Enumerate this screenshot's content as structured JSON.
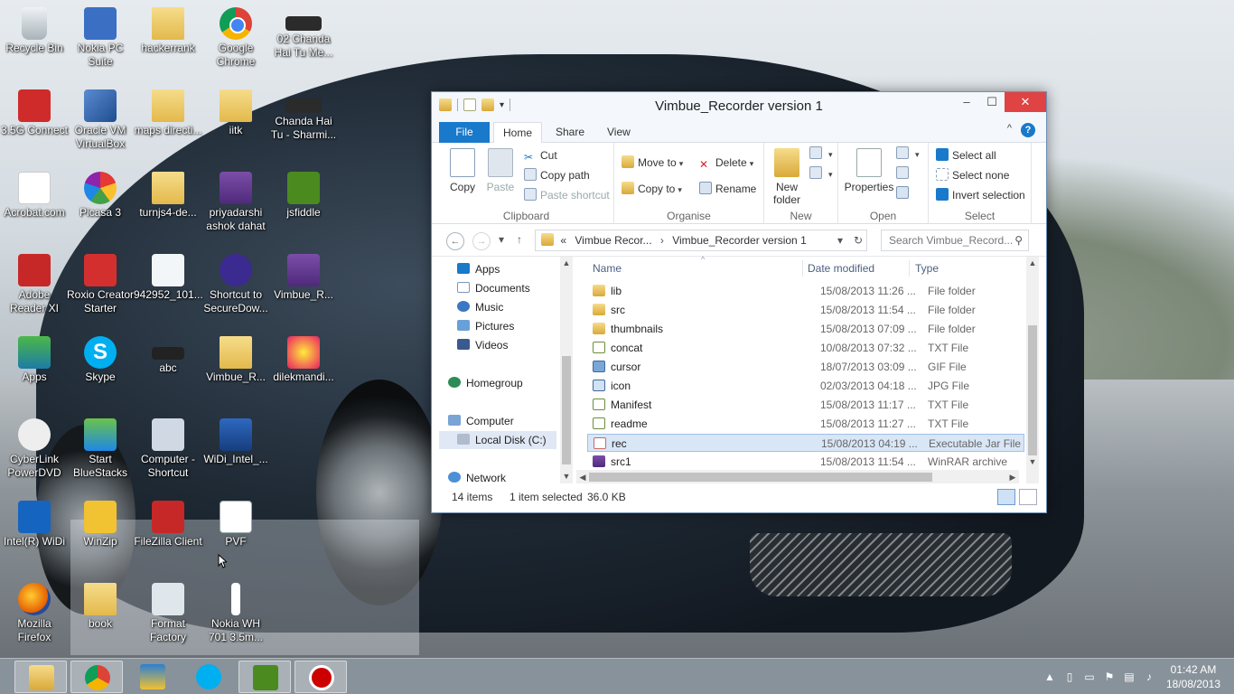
{
  "desktop": {
    "icons": [
      {
        "label": "Recycle Bin"
      },
      {
        "label": "Nokia PC Suite"
      },
      {
        "label": "hackerrank"
      },
      {
        "label": "Google Chrome"
      },
      {
        "label": "02 Chanda Hai Tu Me..."
      },
      {
        "label": "3.5G Connect"
      },
      {
        "label": "Oracle VM VirtualBox"
      },
      {
        "label": "maps directi..."
      },
      {
        "label": "iitk"
      },
      {
        "label": "Chanda Hai Tu - Sharmi..."
      },
      {
        "label": "Acrobat.com"
      },
      {
        "label": "Picasa 3"
      },
      {
        "label": "turnjs4-de..."
      },
      {
        "label": "priyadarshi ashok dahat"
      },
      {
        "label": "jsfiddle"
      },
      {
        "label": "Adobe Reader XI"
      },
      {
        "label": "Roxio Creator Starter"
      },
      {
        "label": "942952_101..."
      },
      {
        "label": "Shortcut to SecureDow..."
      },
      {
        "label": "Vimbue_R..."
      },
      {
        "label": "Apps"
      },
      {
        "label": "Skype"
      },
      {
        "label": "abc"
      },
      {
        "label": "Vimbue_R..."
      },
      {
        "label": "dilekmandi..."
      },
      {
        "label": "CyberLink PowerDVD"
      },
      {
        "label": "Start BlueStacks"
      },
      {
        "label": "Computer - Shortcut"
      },
      {
        "label": "WiDi_Intel_..."
      },
      {
        "label": "Intel(R) WiDi"
      },
      {
        "label": "WinZip"
      },
      {
        "label": "FileZilla Client"
      },
      {
        "label": "PVF"
      },
      {
        "label": "Mozilla Firefox"
      },
      {
        "label": "book"
      },
      {
        "label": "Format Factory"
      },
      {
        "label": "Nokia WH 701 3.5m..."
      }
    ]
  },
  "explorer": {
    "title": "Vimbue_Recorder version 1",
    "window_controls": {
      "minimize": "–",
      "maximize": "☐",
      "close": "✕"
    },
    "tabs": {
      "file": "File",
      "home": "Home",
      "share": "Share",
      "view": "View"
    },
    "help": "?",
    "ribbon": {
      "clipboard": {
        "label": "Clipboard",
        "copy": "Copy",
        "paste": "Paste",
        "cut": "Cut",
        "copy_path": "Copy path",
        "paste_shortcut": "Paste shortcut"
      },
      "organise": {
        "label": "Organise",
        "move_to": "Move to",
        "copy_to": "Copy to",
        "delete": "Delete",
        "rename": "Rename"
      },
      "new": {
        "label": "New",
        "new_folder": "New folder"
      },
      "open": {
        "label": "Open",
        "properties": "Properties"
      },
      "select": {
        "label": "Select",
        "select_all": "Select all",
        "select_none": "Select none",
        "invert_selection": "Invert selection"
      }
    },
    "address": {
      "prefix": "«",
      "crumbs": [
        "Vimbue Recor...",
        "Vimbue_Recorder version 1"
      ],
      "separator": "›"
    },
    "search": {
      "placeholder": "Search Vimbue_Record..."
    },
    "nav_pane": {
      "items": [
        "Apps",
        "Documents",
        "Music",
        "Pictures",
        "Videos",
        "Homegroup",
        "Computer",
        "Local Disk (C:)",
        "Network"
      ]
    },
    "columns": {
      "name": "Name",
      "date": "Date modified",
      "type": "Type"
    },
    "files": [
      {
        "name": "lib",
        "date": "15/08/2013 11:26 ...",
        "type": "File folder",
        "kind": "folder"
      },
      {
        "name": "src",
        "date": "15/08/2013 11:54 ...",
        "type": "File folder",
        "kind": "folder"
      },
      {
        "name": "thumbnails",
        "date": "15/08/2013 07:09 ...",
        "type": "File folder",
        "kind": "folder"
      },
      {
        "name": "concat",
        "date": "10/08/2013 07:32 ...",
        "type": "TXT File",
        "kind": "txt"
      },
      {
        "name": "cursor",
        "date": "18/07/2013 03:09 ...",
        "type": "GIF File",
        "kind": "gif"
      },
      {
        "name": "icon",
        "date": "02/03/2013 04:18 ...",
        "type": "JPG File",
        "kind": "jpg"
      },
      {
        "name": "Manifest",
        "date": "15/08/2013 11:17 ...",
        "type": "TXT File",
        "kind": "txt"
      },
      {
        "name": "readme",
        "date": "15/08/2013 11:27 ...",
        "type": "TXT File",
        "kind": "txt"
      },
      {
        "name": "rec",
        "date": "15/08/2013 04:19 ...",
        "type": "Executable Jar File",
        "kind": "jar",
        "selected": true
      },
      {
        "name": "src1",
        "date": "15/08/2013 11:54 ...",
        "type": "WinRAR archive",
        "kind": "rar"
      }
    ],
    "status": {
      "count": "14 items",
      "selection": "1 item selected",
      "size": "36.0 KB"
    }
  },
  "taskbar": {
    "clock_time": "01:42 AM",
    "clock_date": "18/08/2013",
    "tray_caret": "▲"
  }
}
